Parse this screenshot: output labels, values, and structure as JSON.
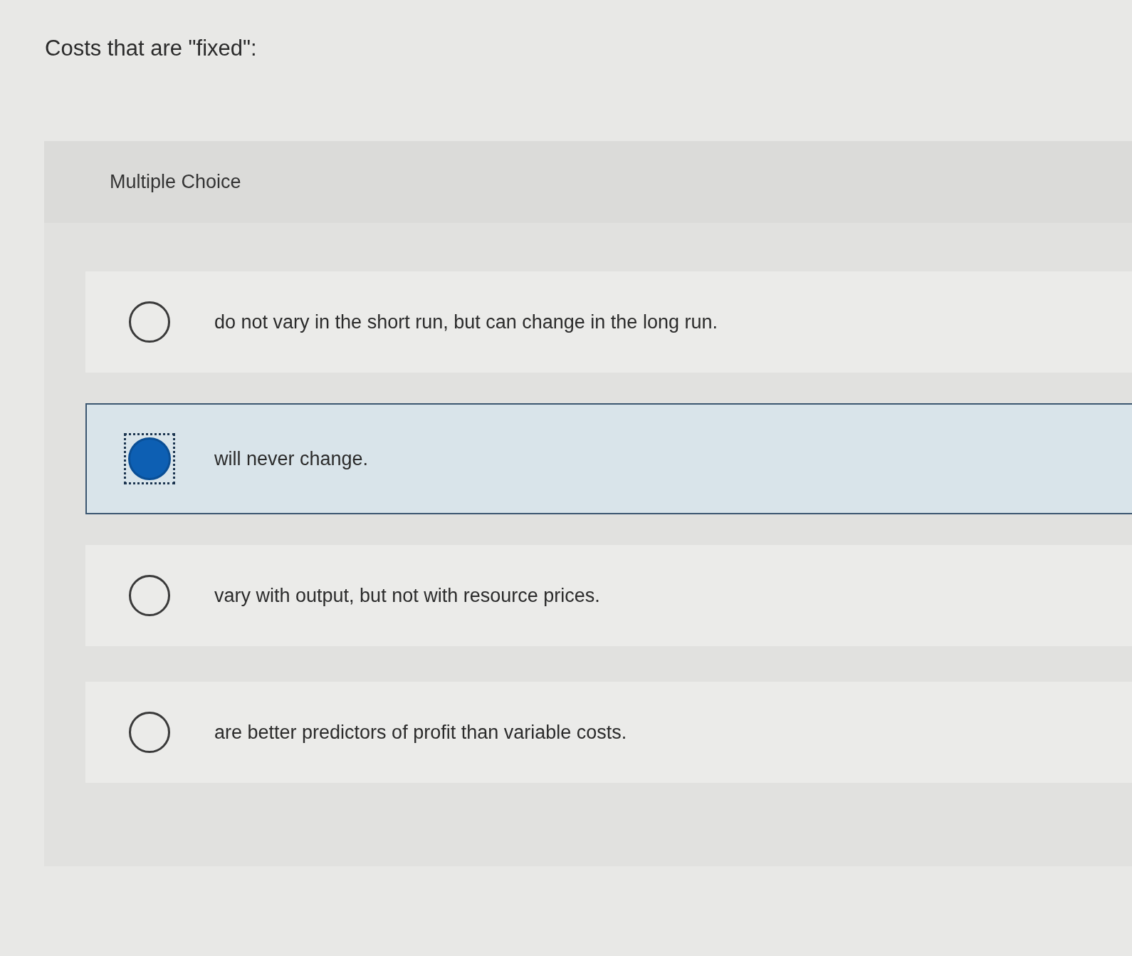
{
  "question": "Costs that are \"fixed\":",
  "panel": {
    "heading": "Multiple Choice",
    "options": [
      {
        "text": "do not vary in the short run, but can change in the long run.",
        "selected": false
      },
      {
        "text": "will never change.",
        "selected": true
      },
      {
        "text": "vary with output, but not with resource prices.",
        "selected": false
      },
      {
        "text": "are better predictors of profit than variable costs.",
        "selected": false
      }
    ]
  }
}
